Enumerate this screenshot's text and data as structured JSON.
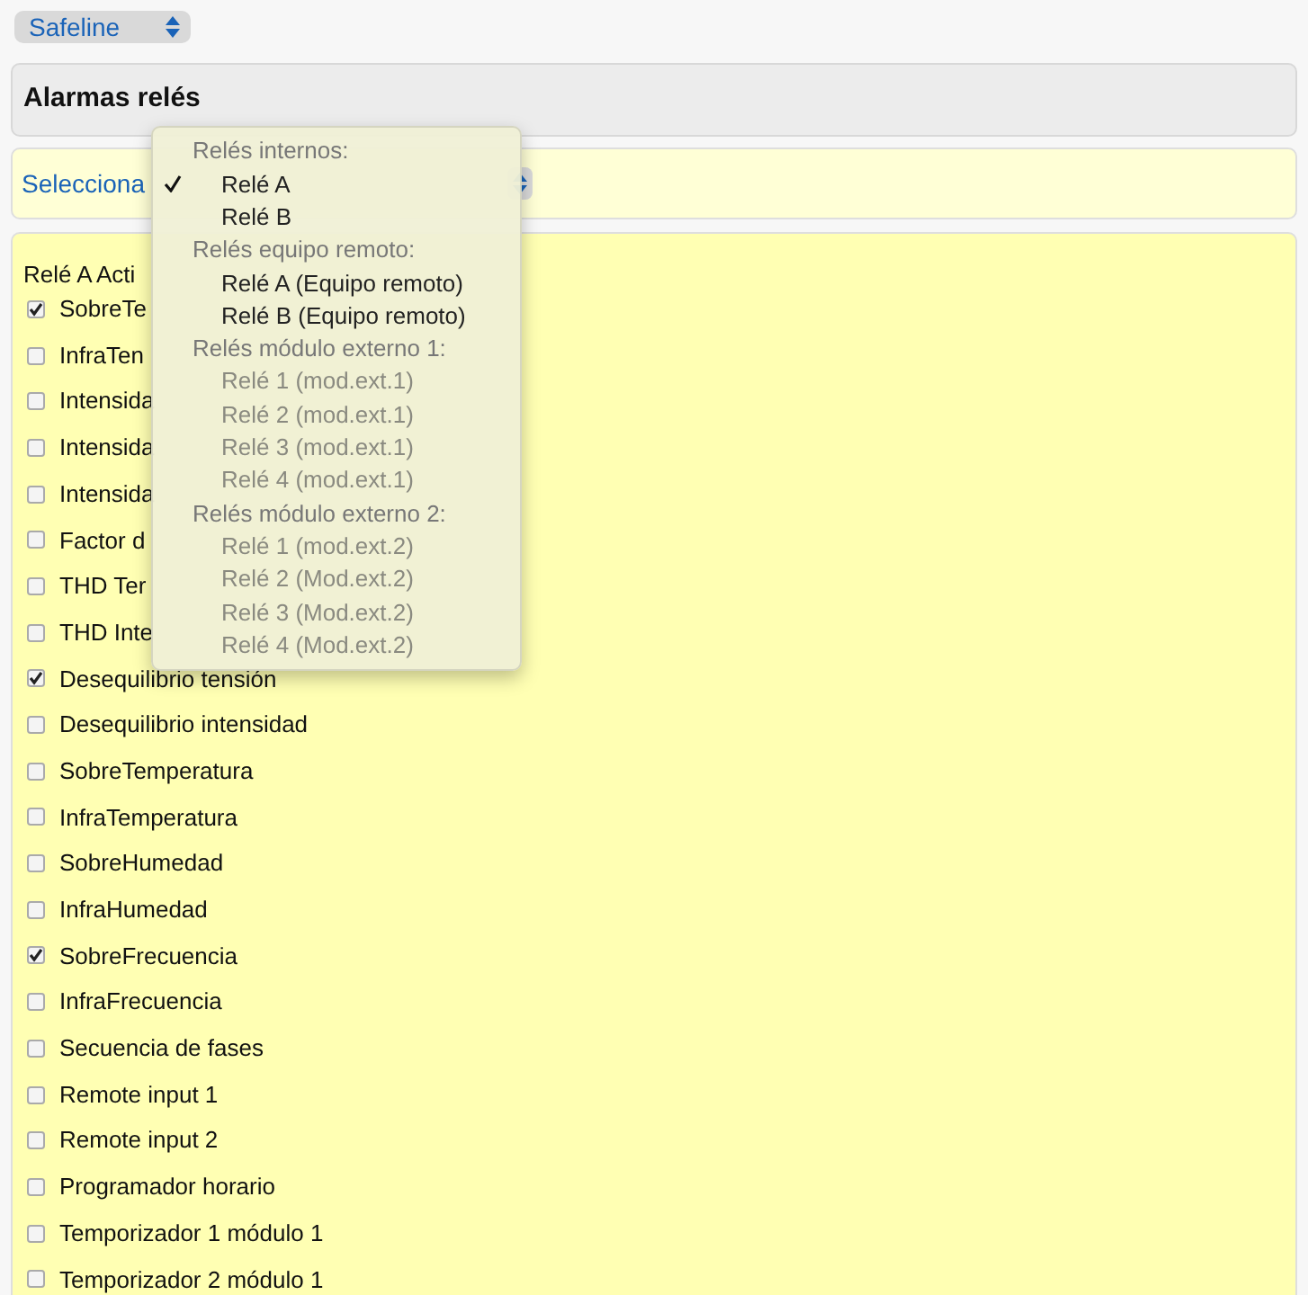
{
  "device_select": {
    "value": "Safeline"
  },
  "header": {
    "title": "Alarmas relés"
  },
  "relay_select": {
    "value": "Selecciona"
  },
  "alarms": {
    "title": "Relé A Acti",
    "items": [
      {
        "label": "SobreTe",
        "checked": true
      },
      {
        "label": "InfraTen",
        "checked": false
      },
      {
        "label": "Intensida",
        "checked": false
      },
      {
        "label": "Intensida",
        "checked": false
      },
      {
        "label": "Intensida",
        "checked": false
      },
      {
        "label": "Factor d",
        "checked": false
      },
      {
        "label": "THD Ter",
        "checked": false
      },
      {
        "label": "THD Inte",
        "checked": false
      },
      {
        "label": "Desequilibrio tensión",
        "checked": true
      },
      {
        "label": "Desequilibrio intensidad",
        "checked": false
      },
      {
        "label": "SobreTemperatura",
        "checked": false
      },
      {
        "label": "InfraTemperatura",
        "checked": false
      },
      {
        "label": "SobreHumedad",
        "checked": false
      },
      {
        "label": "InfraHumedad",
        "checked": false
      },
      {
        "label": "SobreFrecuencia",
        "checked": true
      },
      {
        "label": "InfraFrecuencia",
        "checked": false
      },
      {
        "label": "Secuencia de fases",
        "checked": false
      },
      {
        "label": "Remote input 1",
        "checked": false
      },
      {
        "label": "Remote input 2",
        "checked": false
      },
      {
        "label": "Programador horario",
        "checked": false
      },
      {
        "label": "Temporizador 1 módulo 1",
        "checked": false
      },
      {
        "label": "Temporizador 2 módulo 1",
        "checked": false
      }
    ]
  },
  "dropdown_menu": {
    "items": [
      {
        "kind": "header",
        "label": "Relés internos:"
      },
      {
        "kind": "option",
        "label": "Relé A",
        "selected": true,
        "disabled": false
      },
      {
        "kind": "option",
        "label": "Relé B",
        "selected": false,
        "disabled": false
      },
      {
        "kind": "header",
        "label": "Relés equipo remoto:"
      },
      {
        "kind": "option",
        "label": "Relé A (Equipo remoto)",
        "selected": false,
        "disabled": false
      },
      {
        "kind": "option",
        "label": "Relé B (Equipo remoto)",
        "selected": false,
        "disabled": false
      },
      {
        "kind": "header",
        "label": "Relés módulo externo 1:"
      },
      {
        "kind": "option",
        "label": "Relé 1 (mod.ext.1)",
        "selected": false,
        "disabled": true
      },
      {
        "kind": "option",
        "label": "Relé 2 (mod.ext.1)",
        "selected": false,
        "disabled": true
      },
      {
        "kind": "option",
        "label": "Relé 3 (mod.ext.1)",
        "selected": false,
        "disabled": true
      },
      {
        "kind": "option",
        "label": "Relé 4 (mod.ext.1)",
        "selected": false,
        "disabled": true
      },
      {
        "kind": "header",
        "label": "Relés módulo externo 2:"
      },
      {
        "kind": "option",
        "label": "Relé 1 (mod.ext.2)",
        "selected": false,
        "disabled": true
      },
      {
        "kind": "option",
        "label": "Relé 2 (Mod.ext.2)",
        "selected": false,
        "disabled": true
      },
      {
        "kind": "option",
        "label": "Relé 3 (Mod.ext.2)",
        "selected": false,
        "disabled": true
      },
      {
        "kind": "option",
        "label": "Relé 4 (Mod.ext.2)",
        "selected": false,
        "disabled": true
      }
    ]
  }
}
